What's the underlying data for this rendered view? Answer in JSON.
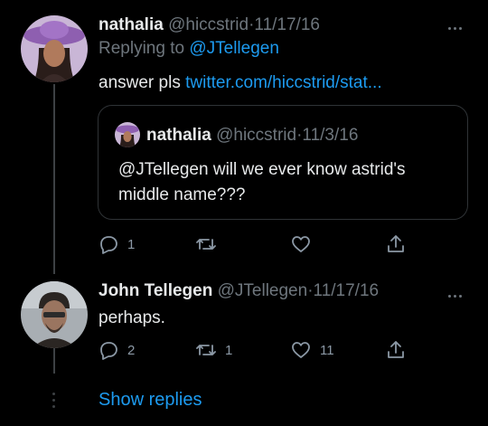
{
  "tweet": {
    "display_name": "nathalia",
    "handle": "@hiccstrid",
    "date_sep": "·",
    "date": "11/17/16",
    "replying_prefix": "Replying to",
    "replying_to": "@JTellegen",
    "text": "answer pls",
    "link": "twitter.com/hiccstrid/stat...",
    "quoted": {
      "display_name": "nathalia",
      "handle": "@hiccstrid",
      "date_sep": "·",
      "date": "11/3/16",
      "text_line1": "@JTellegen will we ever know astrid's",
      "text_line2": "middle name???"
    },
    "stats": {
      "replies": "1",
      "retweets": "",
      "likes": ""
    }
  },
  "reply": {
    "display_name": "John Tellegen",
    "handle": "@JTellegen",
    "date_sep": "·",
    "date": "11/17/16",
    "text": "perhaps.",
    "stats": {
      "replies": "2",
      "retweets": "1",
      "likes": "11"
    }
  },
  "show_replies_label": "Show replies",
  "colors": {
    "background": "#000000",
    "accent": "#1d9bf0",
    "muted": "#6e767d",
    "text": "#e7e9ea"
  }
}
